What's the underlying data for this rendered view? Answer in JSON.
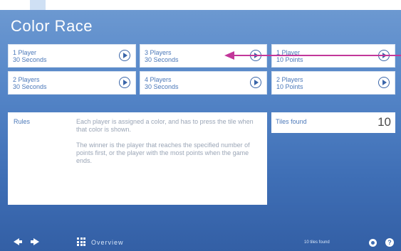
{
  "app": {
    "title": "Color Race"
  },
  "tiles": [
    {
      "line1": "1 Player",
      "line2": "30 Seconds"
    },
    {
      "line1": "3 Players",
      "line2": "30 Seconds"
    },
    {
      "line1": "1 Player",
      "line2": "10 Points"
    },
    {
      "line1": "2 Players",
      "line2": "30 Seconds"
    },
    {
      "line1": "4 Players",
      "line2": "30 Seconds"
    },
    {
      "line1": "2 Players",
      "line2": "10 Points"
    }
  ],
  "rules": {
    "heading": "Rules",
    "p1": "Each player is assigned a color, and has to press the tile when that color is shown.",
    "p2": "The winner is the player that reaches the specified number of points first, or the player with the most points when the game ends."
  },
  "stats": {
    "label": "Tiles found",
    "value": "10"
  },
  "footer": {
    "overview_label": "Overview",
    "status_text": "10 tiles found"
  },
  "icons": {
    "play": "play-icon",
    "back": "arrow-left-icon",
    "forward": "arrow-right-icon",
    "overview": "grid-icon",
    "settings": "gear-icon",
    "help": "help-icon"
  },
  "colors": {
    "accent": "#c2379a",
    "tile_text": "#4b78b9",
    "background": "#5586c8"
  }
}
